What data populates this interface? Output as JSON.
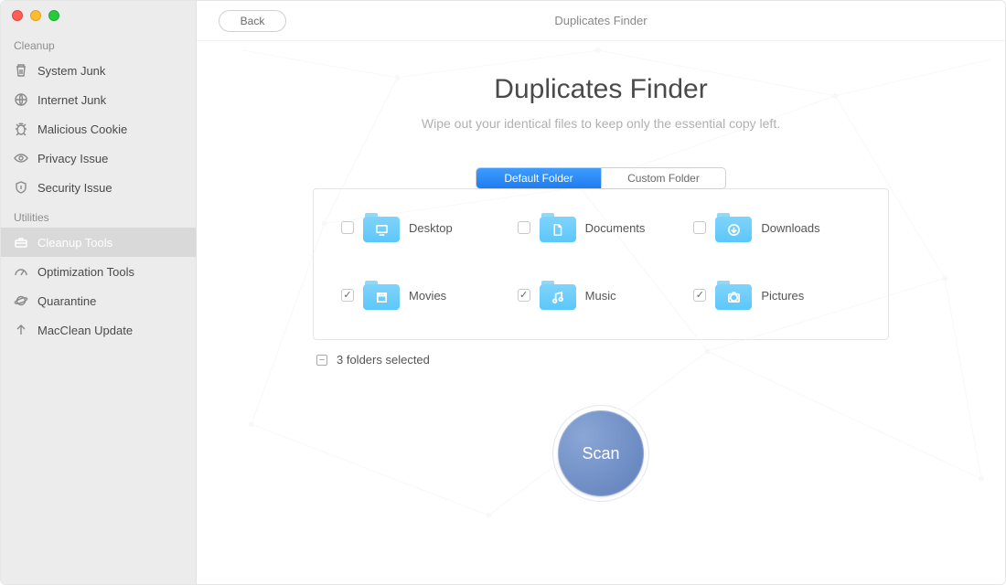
{
  "window_title": "Duplicates Finder",
  "back_label": "Back",
  "sidebar": {
    "sections": [
      {
        "label": "Cleanup",
        "items": [
          {
            "icon": "trash",
            "label": "System Junk",
            "active": false
          },
          {
            "icon": "globe",
            "label": "Internet Junk",
            "active": false
          },
          {
            "icon": "bug",
            "label": "Malicious Cookie",
            "active": false
          },
          {
            "icon": "eye",
            "label": "Privacy Issue",
            "active": false
          },
          {
            "icon": "shield",
            "label": "Security Issue",
            "active": false
          }
        ]
      },
      {
        "label": "Utilities",
        "items": [
          {
            "icon": "toolbox",
            "label": "Cleanup Tools",
            "active": true
          },
          {
            "icon": "gauge",
            "label": "Optimization Tools",
            "active": false
          },
          {
            "icon": "planet",
            "label": "Quarantine",
            "active": false
          },
          {
            "icon": "arrow-up",
            "label": "MacClean Update",
            "active": false
          }
        ]
      }
    ]
  },
  "page": {
    "title": "Duplicates Finder",
    "subtitle": "Wipe out your identical files to keep only the essential copy left.",
    "tabs": {
      "default": "Default Folder",
      "custom": "Custom Folder",
      "active": "default"
    },
    "folders": [
      {
        "name": "Desktop",
        "icon": "desktop",
        "checked": false
      },
      {
        "name": "Documents",
        "icon": "document",
        "checked": false
      },
      {
        "name": "Downloads",
        "icon": "download",
        "checked": false
      },
      {
        "name": "Movies",
        "icon": "movie",
        "checked": true
      },
      {
        "name": "Music",
        "icon": "music",
        "checked": true
      },
      {
        "name": "Pictures",
        "icon": "picture",
        "checked": true
      }
    ],
    "selected_text": "3 folders selected",
    "indeterminate_glyph": "–",
    "scan_label": "Scan"
  }
}
